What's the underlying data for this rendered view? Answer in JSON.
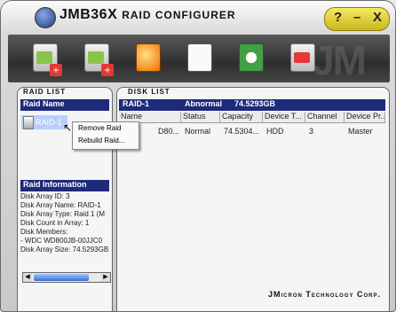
{
  "app": {
    "title": "JMB36X",
    "subtitle": "RAID CONFIGURER"
  },
  "window_controls": {
    "help": "?",
    "minimize": "–",
    "close": "X"
  },
  "toolbar": {
    "watermark": "JM"
  },
  "raid_list": {
    "section_title": "RAID LIST",
    "column_header": "Raid Name",
    "items": [
      "RAID-1"
    ]
  },
  "context_menu": {
    "items": [
      "Remove Raid",
      "Rebuild Raid..."
    ]
  },
  "raid_info": {
    "header": "Raid Information",
    "lines": [
      "Disk Array ID: 3",
      "Disk Array Name: RAID-1",
      "Disk Array Type: Raid 1 (M",
      "Disk Count in Array: 1",
      "Disk Members:",
      "  - WDC WD800JB-00JJC0",
      "Disk Array Size: 74.5293GB"
    ]
  },
  "disk_list": {
    "section_title": "DISK LIST",
    "group": {
      "name": "RAID-1",
      "status": "Abnormal",
      "size": "74.5293GB"
    },
    "columns": [
      "Name",
      "Status",
      "Capacity",
      "Device T...",
      "Channel",
      "Device Pr..."
    ],
    "rows": [
      {
        "name": "D80...",
        "status": "Normal",
        "capacity": "74.5304...",
        "device_type": "HDD",
        "channel": "3",
        "device_pr": "Master"
      }
    ]
  },
  "footer": {
    "company": "JMicron Technology Corp."
  },
  "colors": {
    "header_navy": "#1e2a7a",
    "toolbar_dark": "#3a3a3a",
    "control_yellow": "#e3d23a"
  }
}
